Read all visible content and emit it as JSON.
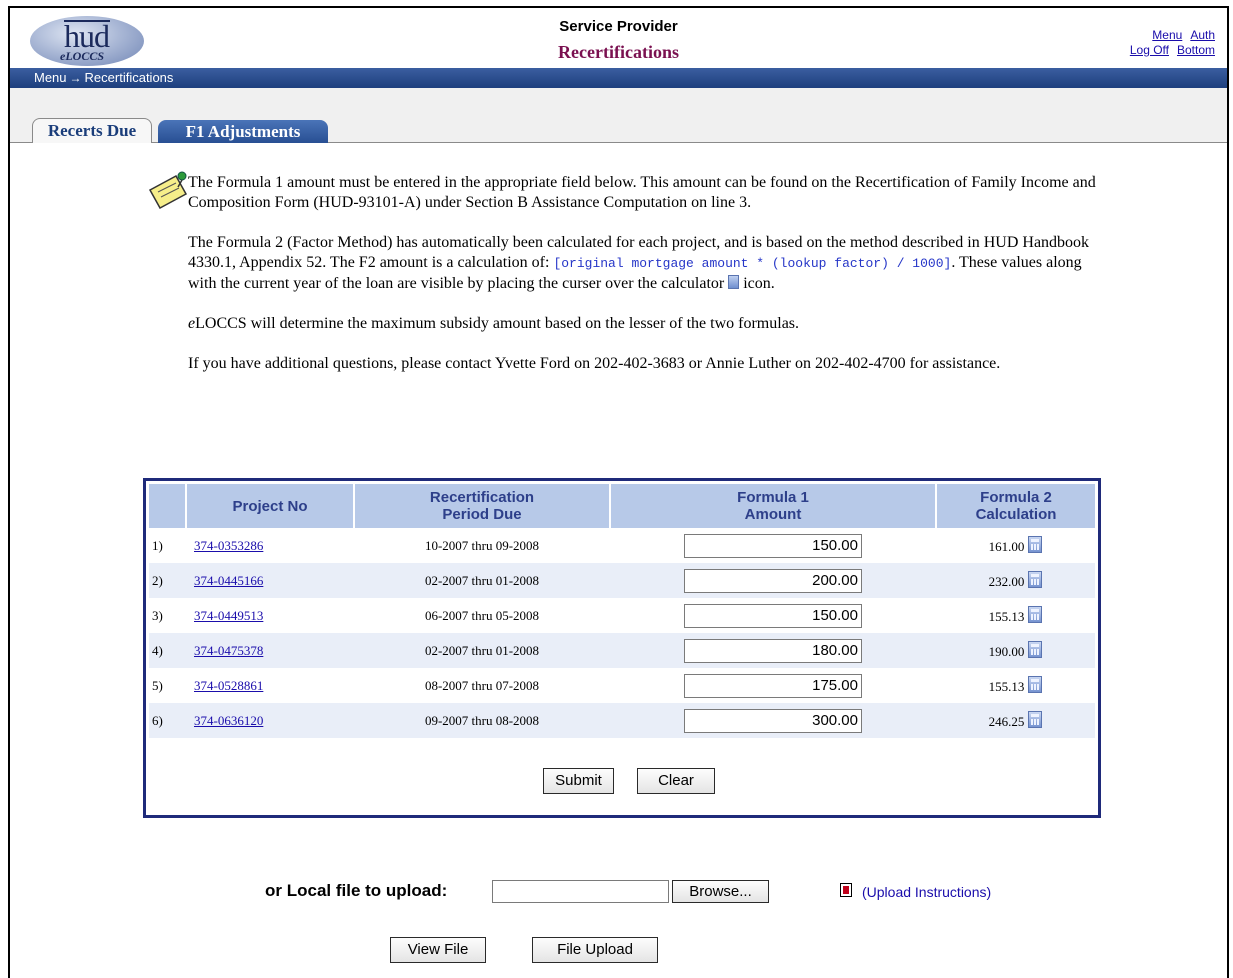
{
  "header": {
    "logo_text": "hud",
    "logo_sub": "eLOCCS",
    "app_title": "Service Provider",
    "page_title": "Recertifications",
    "links": {
      "menu": "Menu",
      "auth": "Auth",
      "logoff": "Log Off",
      "bottom": "Bottom"
    }
  },
  "breadcrumb": {
    "root": "Menu",
    "arrow": "→",
    "current": "Recertifications"
  },
  "tabs": [
    {
      "label": "Recerts Due",
      "active": true
    },
    {
      "label": "F1 Adjustments",
      "active": false
    }
  ],
  "info": {
    "p1": "The Formula 1 amount must be entered in the appropriate field below. This amount can be found on the Recertification of Family Income and Composition Form (HUD-93101-A) under Section B Assistance Computation on line 3.",
    "p2_a": "The Formula 2 (Factor Method) has automatically been calculated for each project, and is based on the method described in HUD Handbook 4330.1, Appendix 52.  The F2 amount is a calculation of: ",
    "p2_code": "[original mortgage amount * (lookup factor) / 1000]",
    "p2_b": ".  These values along with the current year of the loan are visible by placing the curser over the calculator ",
    "p2_c": " icon.",
    "p3_e": "e",
    "p3": "LOCCS will determine the maximum subsidy amount based on the lesser of the two formulas.",
    "p4": "If you have additional questions, please contact Yvette Ford on 202-402-3683 or Annie Luther on 202-402-4700 for assistance."
  },
  "table": {
    "headers": {
      "project": "Project No",
      "period_1": "Recertification",
      "period_2": "Period Due",
      "f1_1": "Formula 1",
      "f1_2": "Amount",
      "f2_1": "Formula 2",
      "f2_2": "Calculation"
    },
    "rows": [
      {
        "num": "1)",
        "project": "374-0353286",
        "period": "10-2007 thru 09-2008",
        "f1": "150.00",
        "f2": "161.00"
      },
      {
        "num": "2)",
        "project": "374-0445166",
        "period": "02-2007 thru 01-2008",
        "f1": "200.00",
        "f2": "232.00"
      },
      {
        "num": "3)",
        "project": "374-0449513",
        "period": "06-2007 thru 05-2008",
        "f1": "150.00",
        "f2": "155.13"
      },
      {
        "num": "4)",
        "project": "374-0475378",
        "period": "02-2007 thru 01-2008",
        "f1": "180.00",
        "f2": "190.00"
      },
      {
        "num": "5)",
        "project": "374-0528861",
        "period": "08-2007 thru 07-2008",
        "f1": "175.00",
        "f2": "155.13"
      },
      {
        "num": "6)",
        "project": "374-0636120",
        "period": "09-2007 thru 08-2008",
        "f1": "300.00",
        "f2": "246.25"
      }
    ],
    "submit_label": "Submit",
    "clear_label": "Clear"
  },
  "upload": {
    "label": "or Local file to upload:",
    "browse_label": "Browse...",
    "instructions_label": "(Upload Instructions)",
    "view_label": "View File",
    "upload_label": "File Upload"
  }
}
